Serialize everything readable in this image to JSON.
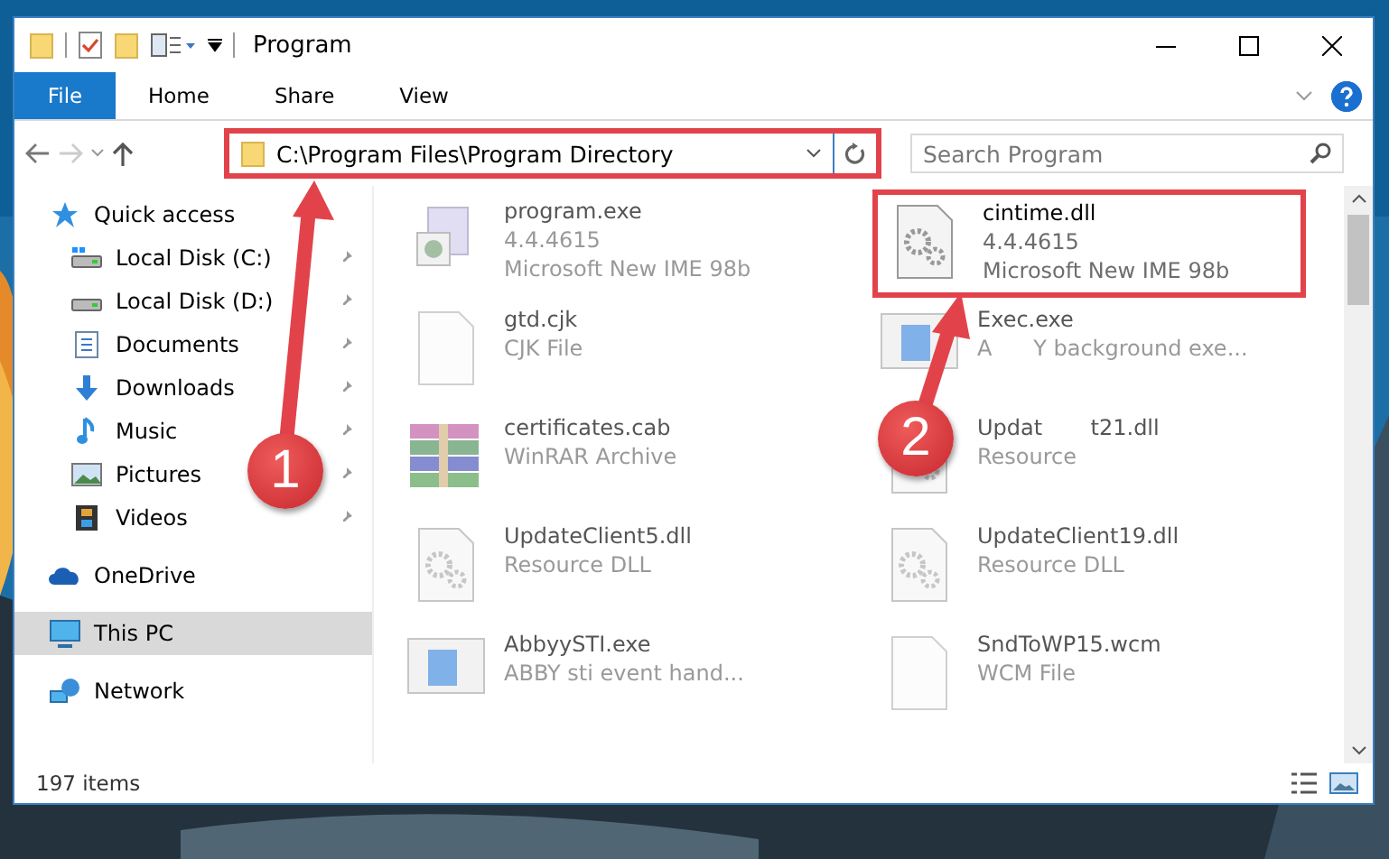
{
  "window": {
    "title": "Program"
  },
  "ribbon": {
    "tabs": [
      {
        "label": "File",
        "kind": "file",
        "selected": false
      },
      {
        "label": "Home",
        "kind": "tab",
        "selected": false
      },
      {
        "label": "Share",
        "kind": "tab",
        "selected": false
      },
      {
        "label": "View",
        "kind": "tab",
        "selected": false
      }
    ]
  },
  "address_bar": {
    "path": "C:\\Program Files\\Program Directory",
    "highlighted": true
  },
  "search": {
    "placeholder": "Search Program"
  },
  "navigation": [
    {
      "label": "Quick access",
      "selected": false,
      "children": [
        {
          "label": "Local Disk (C:)",
          "pinned": true,
          "selected": false
        },
        {
          "label": "Local Disk (D:)",
          "pinned": true,
          "selected": false
        },
        {
          "label": "Documents",
          "pinned": true,
          "selected": false
        },
        {
          "label": "Downloads",
          "pinned": true,
          "selected": false
        },
        {
          "label": "Music",
          "pinned": true,
          "selected": false
        },
        {
          "label": "Pictures",
          "pinned": true,
          "selected": false
        },
        {
          "label": "Videos",
          "pinned": true,
          "selected": false
        }
      ]
    },
    {
      "label": "OneDrive",
      "selected": false
    },
    {
      "label": "This PC",
      "selected": true
    },
    {
      "label": "Network",
      "selected": false
    }
  ],
  "files": [
    {
      "kind": "exe",
      "name": "program.exe",
      "lines": [
        "4.4.4615",
        "Microsoft New IME 98b"
      ],
      "dimmed": true,
      "highlighted": false
    },
    {
      "kind": "dll",
      "name": "cintime.dll",
      "lines": [
        "4.4.4615",
        "Microsoft New IME 98b"
      ],
      "dimmed": false,
      "highlighted": true
    },
    {
      "kind": "blank",
      "name": "gtd.cjk",
      "lines": [
        "CJK File"
      ],
      "dimmed": true,
      "highlighted": false
    },
    {
      "kind": "app",
      "name": "Exec.exe",
      "lines": [
        "A      Y background exe..."
      ],
      "dimmed": true,
      "highlighted": false
    },
    {
      "kind": "archive",
      "name": "certificates.cab",
      "lines": [
        "WinRAR Archive"
      ],
      "dimmed": true,
      "highlighted": false
    },
    {
      "kind": "dll",
      "name": "Updat       t21.dll",
      "lines": [
        "Resource"
      ],
      "dimmed": true,
      "highlighted": false
    },
    {
      "kind": "dll",
      "name": "UpdateClient5.dll",
      "lines": [
        "Resource DLL"
      ],
      "dimmed": true,
      "highlighted": false
    },
    {
      "kind": "dll",
      "name": "UpdateClient19.dll",
      "lines": [
        "Resource DLL"
      ],
      "dimmed": true,
      "highlighted": false
    },
    {
      "kind": "app",
      "name": "AbbyySTI.exe",
      "lines": [
        "ABBY sti event hand..."
      ],
      "dimmed": true,
      "highlighted": false
    },
    {
      "kind": "blank",
      "name": "SndToWP15.wcm",
      "lines": [
        "WCM File"
      ],
      "dimmed": true,
      "highlighted": false
    }
  ],
  "status_bar": {
    "count": "197 items"
  },
  "annotations": [
    {
      "number": "1"
    },
    {
      "number": "2"
    }
  ]
}
